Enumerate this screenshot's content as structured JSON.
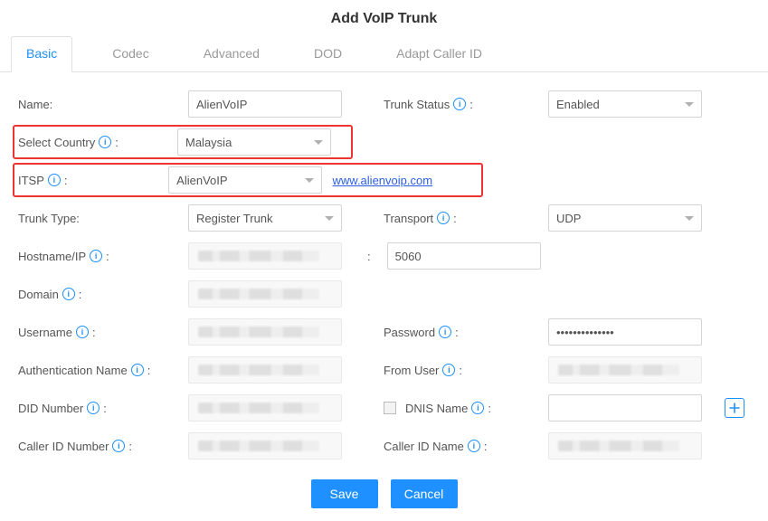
{
  "title": "Add VoIP Trunk",
  "tabs": {
    "basic": "Basic",
    "codec": "Codec",
    "advanced": "Advanced",
    "dod": "DOD",
    "adapt": "Adapt Caller ID"
  },
  "labels": {
    "name": "Name:",
    "trunk_status": "Trunk Status",
    "select_country": "Select Country",
    "itsp": "ITSP",
    "trunk_type": "Trunk Type:",
    "transport": "Transport",
    "hostname": "Hostname/IP",
    "domain": "Domain",
    "username": "Username",
    "password": "Password",
    "auth_name": "Authentication Name",
    "from_user": "From User",
    "did_number": "DID Number",
    "dnis_name": "DNIS Name",
    "caller_id_number": "Caller ID Number",
    "caller_id_name": "Caller ID Name"
  },
  "values": {
    "name": "AlienVoIP",
    "trunk_status": "Enabled",
    "country": "Malaysia",
    "itsp": "AlienVoIP",
    "itsp_link_text": "www.alienvoip.com",
    "itsp_link_href": "http://www.alienvoip.com",
    "trunk_type": "Register Trunk",
    "transport": "UDP",
    "port": "5060",
    "password_mask": "••••••••••••••",
    "dnis_checked": false
  },
  "buttons": {
    "save": "Save",
    "cancel": "Cancel"
  },
  "punct": {
    "colon": ":",
    "host_port_sep": ":"
  }
}
